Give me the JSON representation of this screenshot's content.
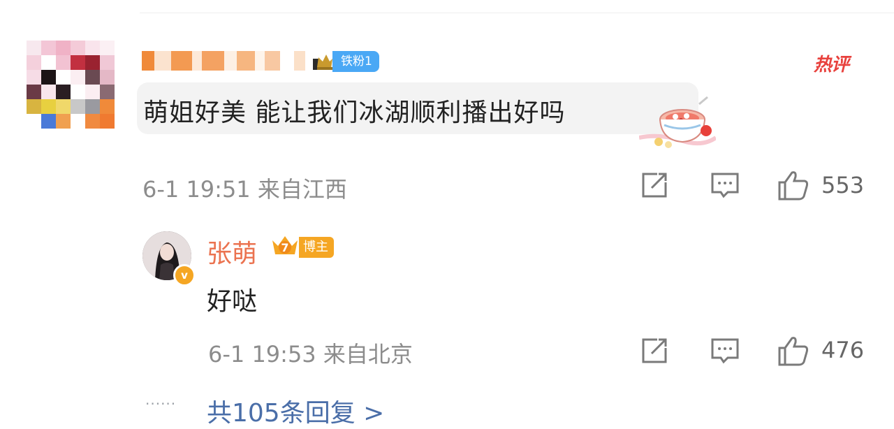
{
  "comment": {
    "user_badge": "铁粉1",
    "hot_tag": "热评",
    "text": "萌姐好美 能让我们冰湖顺利播出好吗",
    "meta": "6-1 19:51 来自江西",
    "likes": "553",
    "icons": [
      "share-icon",
      "comment-icon",
      "like-icon"
    ]
  },
  "reply": {
    "author": "张萌",
    "author_badge": "博主",
    "crown_level": "7",
    "verified_mark": "v",
    "text": "好哒",
    "meta": "6-1 19:53 来自北京",
    "likes": "476",
    "icons": [
      "share-icon",
      "comment-icon",
      "like-icon"
    ]
  },
  "thread": {
    "dots": "······",
    "more_replies": "共105条回复 >"
  },
  "colors": {
    "accent_name": "#eb7350",
    "link": "#4a6ea8",
    "hot": "#e8413d",
    "fan_badge": "#4aa8f5",
    "blogger_badge": "#f5a623",
    "meta": "#8c8c8c"
  }
}
